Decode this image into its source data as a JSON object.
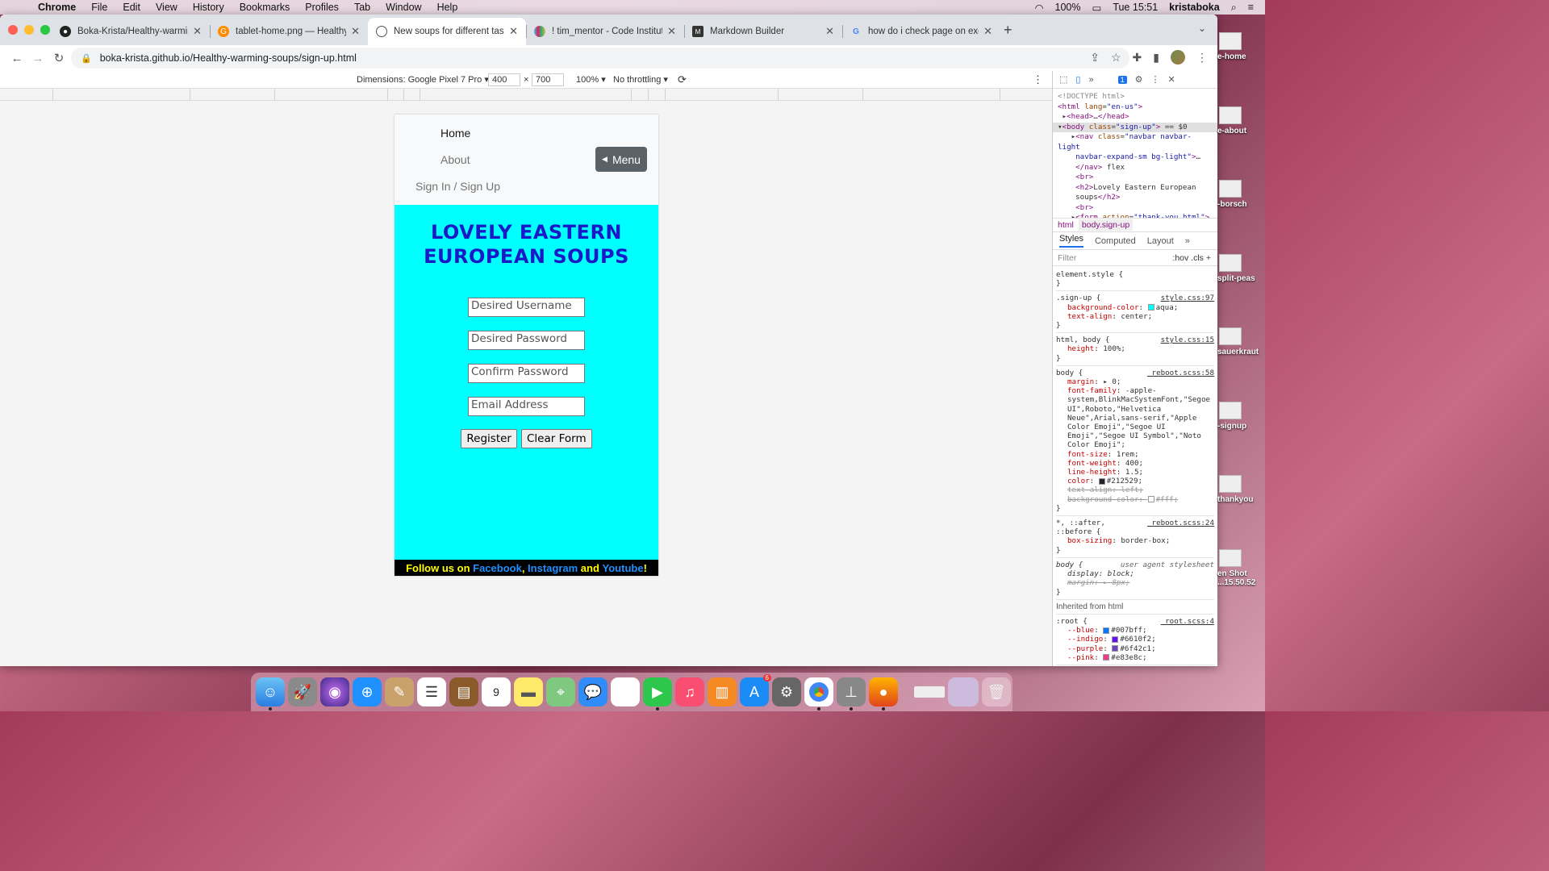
{
  "menubar": {
    "app": "Chrome",
    "items": [
      "File",
      "Edit",
      "View",
      "History",
      "Bookmarks",
      "Profiles",
      "Tab",
      "Window",
      "Help"
    ],
    "battery": "100%",
    "clock": "Tue 15:51",
    "user": "kristaboka"
  },
  "tabs": [
    {
      "title": "Boka-Krista/Healthy-warming-",
      "icon": "github-icon"
    },
    {
      "title": "tablet-home.png — Healthy-w",
      "icon": "gitpod-icon"
    },
    {
      "title": "New soups for different tastes",
      "icon": "globe-icon"
    },
    {
      "title": "! tim_mentor - Code Institute -",
      "icon": "slack-icon"
    },
    {
      "title": "Markdown Builder",
      "icon": "markdown-icon"
    },
    {
      "title": "how do i check page on excel s",
      "icon": "google-icon"
    }
  ],
  "omnibox": {
    "url": "boka-krista.github.io/Healthy-warming-soups/sign-up.html"
  },
  "devbar": {
    "dimensions": "Dimensions: Google Pixel 7 Pro ▾",
    "width": "400",
    "height": "700",
    "times": "×",
    "zoom": "100% ▾",
    "throttle": "No throttling ▾"
  },
  "page": {
    "nav": {
      "home": "Home",
      "about": "About",
      "signin": "Sign In / Sign Up",
      "menu": "Menu"
    },
    "title_line1": "LOVELY EASTERN",
    "title_line2": "EUROPEAN SOUPS",
    "form": {
      "username": "Desired Username",
      "password": "Desired Password",
      "confirm": "Confirm Password",
      "email": "Email Address",
      "register": "Register",
      "clear": "Clear Form"
    },
    "footer": {
      "prefix": "Follow us on ",
      "facebook": "Facebook",
      "comma": ", ",
      "instagram": "Instagram",
      "and": " and ",
      "youtube": "Youtube",
      "bang": "!"
    }
  },
  "devtools": {
    "issues": "1",
    "crumb1": "html",
    "crumb2": "body.sign-up",
    "tabs": [
      "Styles",
      "Computed",
      "Layout"
    ],
    "filter_placeholder": "Filter",
    "filter_opts": ":hov  .cls  +",
    "inherited": "Inherited from html"
  },
  "desktop_icons": [
    "e-home",
    "e-about",
    "-borsch",
    "split-peas",
    "sauerkraut",
    "-signup",
    "thankyou",
    "en Shot\n...15.50.52"
  ]
}
